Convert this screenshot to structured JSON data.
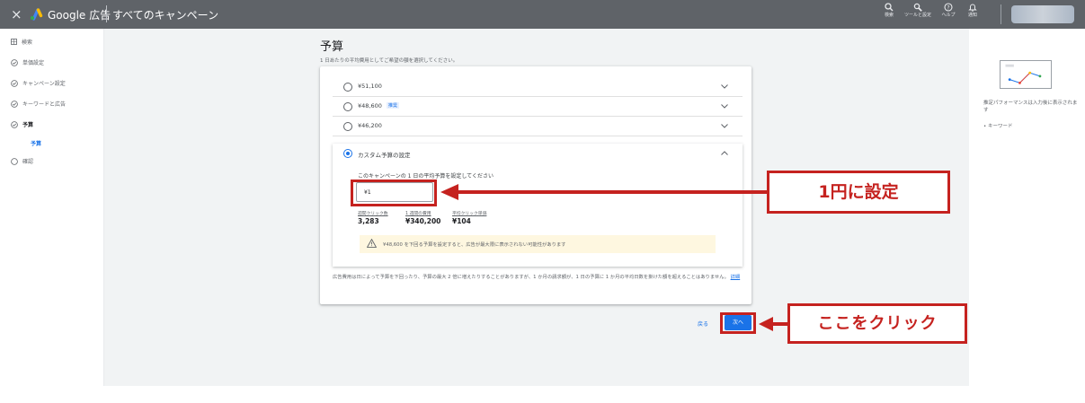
{
  "topbar": {
    "close_glyph": "×",
    "brand": "Google 広告",
    "campaigns": "すべてのキャンペーン",
    "tools": [
      {
        "label": "検索",
        "icon": "search-icon"
      },
      {
        "label": "ツールと設定",
        "icon": "wrench-icon"
      },
      {
        "label": "ヘルプ",
        "icon": "help-icon"
      },
      {
        "label": "通知",
        "icon": "bell-icon"
      }
    ]
  },
  "sidebar": {
    "items": [
      {
        "label": "検索",
        "icon": "grid-icon"
      },
      {
        "label": "単価設定",
        "icon": "check-circle-icon"
      },
      {
        "label": "キャンペーン設定",
        "icon": "check-circle-icon"
      },
      {
        "label": "キーワードと広告",
        "icon": "check-circle-icon"
      },
      {
        "label": "予算",
        "icon": "check-circle-icon"
      },
      {
        "label": "予算",
        "icon": ""
      },
      {
        "label": "確認",
        "icon": "empty-circle-icon"
      }
    ]
  },
  "main": {
    "title": "予算",
    "subtitle": "1 日あたりの平均費用としてご希望の額を選択してください。",
    "options": [
      {
        "price": "¥51,100",
        "badge": ""
      },
      {
        "price": "¥48,600",
        "badge": "推奨"
      },
      {
        "price": "¥46,200",
        "badge": ""
      }
    ],
    "custom": {
      "title": "カスタム予算の設定",
      "question": "このキャンペーンの 1 日の平均予算を設定してください",
      "input_value": "¥1",
      "estimates": [
        {
          "label": "週間クリック数",
          "value": "3,283"
        },
        {
          "label": "1 週間の費用",
          "value": "¥340,200"
        },
        {
          "label": "平均クリック単価",
          "value": "¥104"
        }
      ],
      "warning": "¥48,600 を下回る予算を設定すると、広告が最大限に表示されない可能性があります"
    },
    "footnote": "広告費用は日によって予算を下回ったり、予算の最大 2 倍に増えたりすることがありますが、1 か月の請求額が、1 日の予算に 1 か月の平均日数を掛けた額を超えることはありません。",
    "footnote_link": "詳細",
    "back_label": "戻る",
    "next_label": "次へ"
  },
  "right_panel": {
    "text": "推定パフォーマンスは入力後に表示されます",
    "bullet": "• キーワード"
  },
  "annotations": {
    "callout1": "1円に設定",
    "callout2": "ここをクリック",
    "color": "#c5221f"
  },
  "colors": {
    "topbar": "#5f6368",
    "primary": "#1a73e8",
    "background": "#f1f3f4"
  }
}
